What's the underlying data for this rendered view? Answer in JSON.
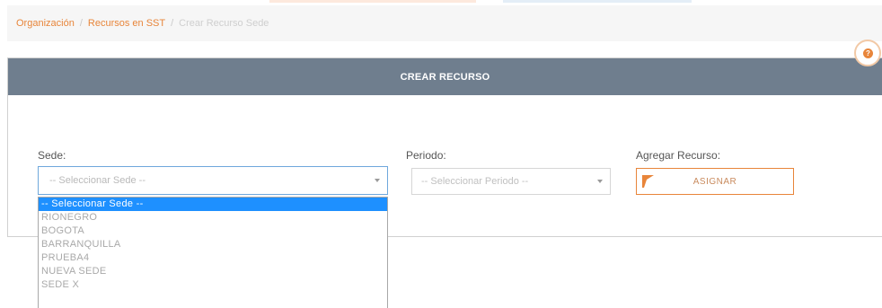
{
  "breadcrumb": {
    "items": [
      {
        "label": "Organización"
      },
      {
        "label": "Recursos en SST"
      },
      {
        "label": "Crear Recurso Sede"
      }
    ],
    "separator": "/"
  },
  "panel": {
    "title": "CREAR RECURSO",
    "help_icon": "question-circle-icon"
  },
  "form": {
    "sede": {
      "label": "Sede:",
      "selected": "-- Seleccionar Sede --",
      "options": [
        "-- Seleccionar Sede --",
        "RIONEGRO",
        "BOGOTA",
        "BARRANQUILLA",
        "PRUEBA4",
        "NUEVA SEDE",
        "SEDE X"
      ],
      "open": true,
      "highlighted_index": 0
    },
    "periodo": {
      "label": "Periodo:",
      "selected": "-- Seleccionar Periodo --"
    },
    "agregar": {
      "label": "Agregar Recurso:",
      "button_label": "ASIGNAR",
      "button_icon": "orange-flag-icon"
    }
  },
  "colors": {
    "accent": "#e8853a",
    "header": "#6f7e8e",
    "selection": "#1e90ff",
    "focus_border": "#6fa8dc"
  }
}
